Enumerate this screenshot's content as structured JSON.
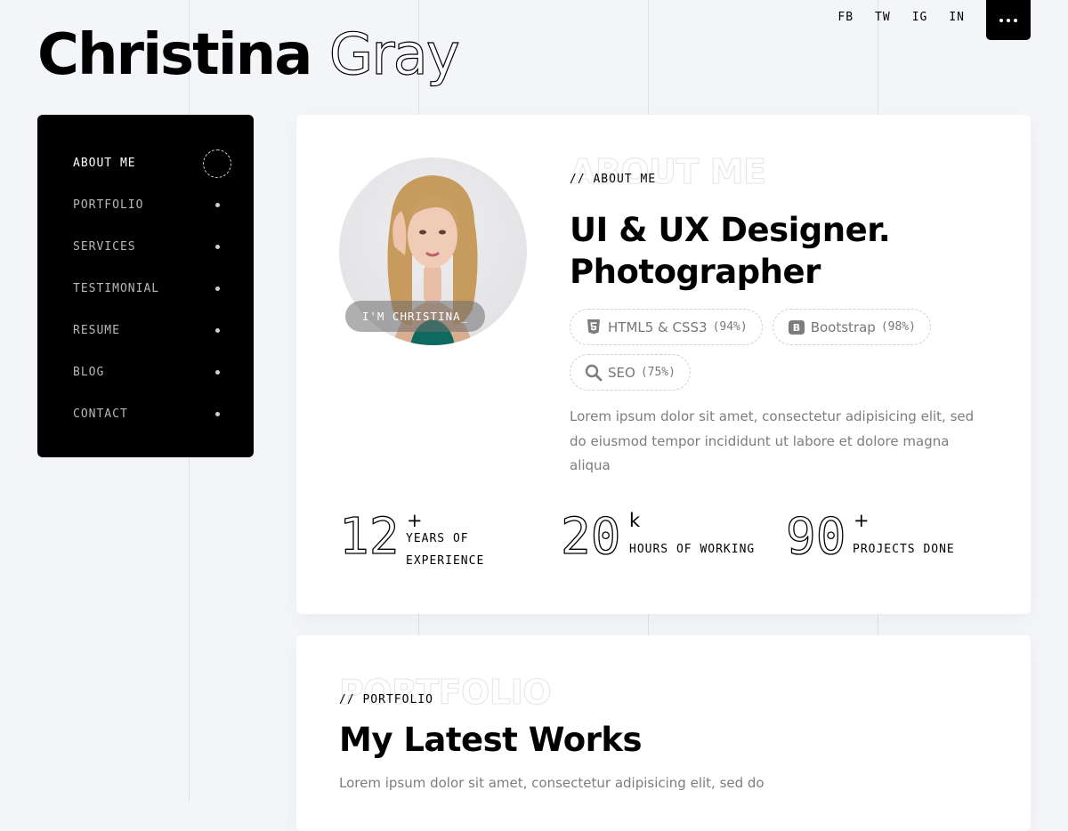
{
  "brand": {
    "first_name": "Christina",
    "last_name": "Gray"
  },
  "social": [
    {
      "label": "FB",
      "icon": "facebook-link"
    },
    {
      "label": "TW",
      "icon": "twitter-link"
    },
    {
      "label": "IG",
      "icon": "instagram-link"
    },
    {
      "label": "IN",
      "icon": "linkedin-link"
    }
  ],
  "menu_button": {
    "icon": "dots-menu-icon"
  },
  "nav": {
    "active_index": 0,
    "items": [
      {
        "label": "ABOUT ME"
      },
      {
        "label": "PORTFOLIO"
      },
      {
        "label": "SERVICES"
      },
      {
        "label": "TESTIMONIAL"
      },
      {
        "label": "RESUME"
      },
      {
        "label": "BLOG"
      },
      {
        "label": "CONTACT"
      }
    ]
  },
  "about": {
    "bg_title": "ABOUT ME",
    "subtitle": "// ABOUT ME",
    "title_line1": "UI & UX Designer.",
    "title_line2": "Photographer",
    "photo_caption": "I'M CHRISTINA_",
    "skills": [
      {
        "name": "HTML5 & CSS3",
        "level": "(94%)",
        "icon": "html5-icon"
      },
      {
        "name": "Bootstrap",
        "level": "(98%)",
        "icon": "bootstrap-icon"
      },
      {
        "name": "SEO",
        "level": "(75%)",
        "icon": "search-icon"
      }
    ],
    "description": "Lorem ipsum dolor sit amet, consectetur adipisicing elit, sed do eiusmod tempor incididunt ut labore et dolore magna aliqua",
    "stats": [
      {
        "number": "12",
        "symbol": "+",
        "label_line1": "YEARS OF",
        "label_line2": "EXPERIENCE"
      },
      {
        "number": "20",
        "symbol": "k",
        "label_line1": "HOURS OF WORKING",
        "label_line2": ""
      },
      {
        "number": "90",
        "symbol": "+",
        "label_line1": "PROJECTS DONE",
        "label_line2": ""
      }
    ]
  },
  "portfolio": {
    "bg_title": "PORTFOLIO",
    "subtitle": "// PORTFOLIO",
    "title": "My Latest Works",
    "description": "Lorem ipsum dolor sit amet, consectetur adipisicing elit, sed do"
  },
  "colors": {
    "background": "#f3f5f8",
    "card": "#ffffff",
    "sidebar": "#000000",
    "text": "#000000",
    "muted_text": "#7d7d7d",
    "grid_line": "#dde0e4"
  }
}
